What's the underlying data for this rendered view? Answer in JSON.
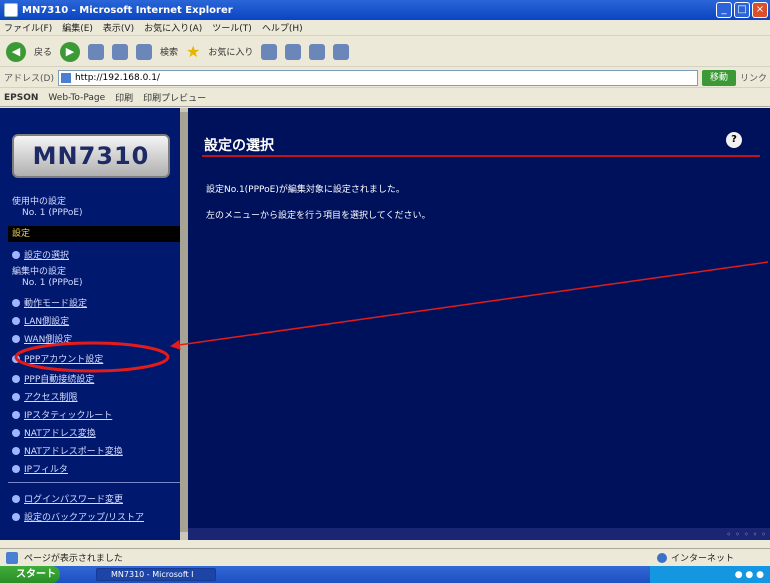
{
  "window": {
    "title": "MN7310 - Microsoft Internet Explorer",
    "buttons": [
      "_",
      "□",
      "×"
    ]
  },
  "menubar": [
    "ファイル(F)",
    "編集(E)",
    "表示(V)",
    "お気に入り(A)",
    "ツール(T)",
    "ヘルプ(H)"
  ],
  "toolbar": {
    "back": "戻る",
    "search": "検索",
    "favorites": "お気に入り"
  },
  "address": {
    "label": "アドレス(D)",
    "url": "http://192.168.0.1/",
    "go": "移動",
    "links": "リンク"
  },
  "links": {
    "epson": "EPSON",
    "web_to_page": "Web-To-Page",
    "print": "印刷",
    "preview": "印刷プレビュー"
  },
  "sidebar": {
    "logo": "MN7310",
    "using_setting_label": "使用中の設定",
    "using_setting_value": "No. 1 (PPPoE)",
    "current_section": "設定",
    "select_setting": "設定の選択",
    "editing_label": "編集中の設定",
    "editing_value": "No. 1 (PPPoE)",
    "items": [
      "動作モード設定",
      "LAN側設定",
      "WAN側設定",
      "PPPアカウント設定",
      "PPP自動接続設定",
      "アクセス制限",
      "IPスタティックルート",
      "NATアドレス変換",
      "NATアドレスポート変換",
      "IPフィルタ"
    ],
    "bottom_items": [
      "ログインパスワード変更",
      "設定のバックアップ/リストア"
    ]
  },
  "main": {
    "title": "設定の選択",
    "help": "?",
    "message_1": "設定No.1(PPPoE)が編集対象に設定されました。",
    "message_2": "左のメニューから設定を行う項目を選択してください。"
  },
  "statusbar": {
    "text": "ページが表示されました",
    "zone": "インターネット"
  },
  "taskbar": {
    "start": "スタート",
    "task": "MN7310 - Microsoft I"
  },
  "colors": {
    "sidebar_bg": "#00196f",
    "main_bg": "#00115b",
    "accent_red": "#c0121e",
    "annotation_red": "#e31b1b"
  }
}
